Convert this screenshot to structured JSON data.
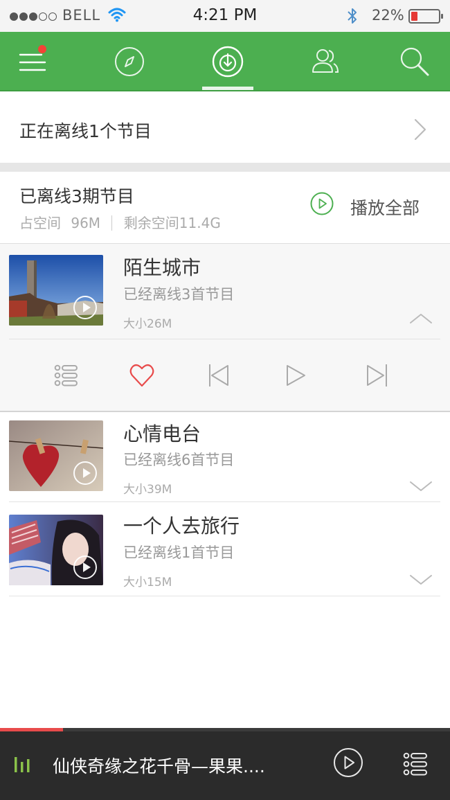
{
  "status_bar": {
    "carrier": "BELL",
    "signal_bars_filled": 3,
    "signal_bars_total": 5,
    "time": "4:21 PM",
    "battery_percent": "22%",
    "battery_level": 0.22
  },
  "nav": {
    "tabs": [
      "menu-icon",
      "compass-icon",
      "download-icon",
      "users-icon",
      "search-icon"
    ],
    "active_tab": 2,
    "notification_dot": true,
    "accent": "#4caf50"
  },
  "downloading": {
    "label": "正在离线1个节目"
  },
  "summary": {
    "title": "已离线3期节目",
    "used_label": "占空间",
    "used_value": "96M",
    "free_label": "剩余空间11.4G",
    "play_all": "播放全部"
  },
  "programs": [
    {
      "title": "陌生城市",
      "count": "已经离线3首节目",
      "size": "大小26M",
      "expanded": true
    },
    {
      "title": "心情电台",
      "count": "已经离线6首节目",
      "size": "大小39M",
      "expanded": false
    },
    {
      "title": "一个人去旅行",
      "count": "已经离线1首节目",
      "size": "大小15M",
      "expanded": false
    }
  ],
  "player": {
    "song": "仙侠奇缘之花千骨—果果....",
    "progress": 0.14,
    "progress_color": "#e84b4b"
  },
  "colors": {
    "green": "#4caf50",
    "heart": "#e84b4b",
    "player_bg": "#2b2b2b"
  }
}
